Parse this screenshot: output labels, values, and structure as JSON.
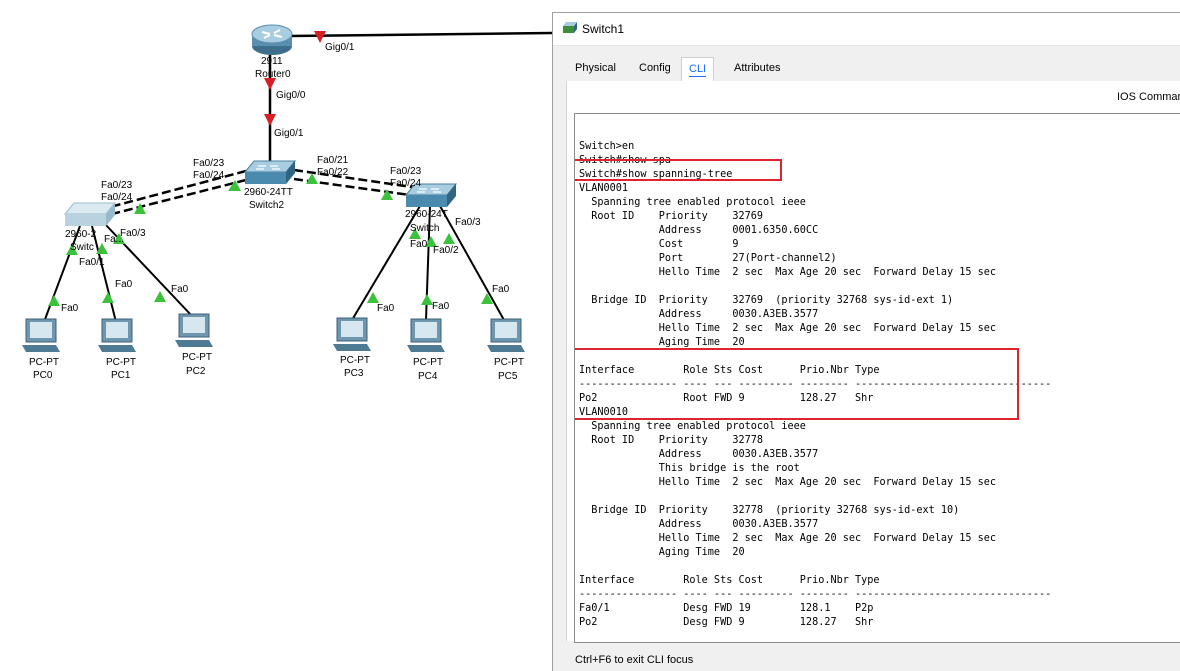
{
  "topology": {
    "labels": {
      "router_model": "2911",
      "router_name": "Router0",
      "router_gig01": "Gig0/1",
      "router_gig00": "Gig0/0",
      "sw2_gig01": "Gig0/1",
      "sw2_fa023": "Fa0/23",
      "sw2_fa024": "Fa0/24",
      "sw2_fa021": "Fa0/21",
      "sw2_fa022": "Fa0/22",
      "sw2_model": "2960-24TT",
      "sw2_name": "Switch2",
      "swl_fa023": "Fa0/23",
      "swl_fa024": "Fa0/24",
      "swl_model": "2960-2",
      "swl_name": "Switc",
      "swl_fa01": "Fa0/1",
      "swl_fa02": "Fa...",
      "swl_fa03": "Fa0/3",
      "swr_fa023": "Fa0/23",
      "swr_fa024": "Fa0/24",
      "swr_model": "2960-24T",
      "swr_name": "Switch",
      "swr_fa0": "Fa0",
      "swr_fa02": "Fa0/2",
      "swr_fa03": "Fa0/3",
      "pc_port": "Fa0",
      "pc_type": "PC-PT",
      "pcs": [
        "PC0",
        "PC1",
        "PC2",
        "PC3",
        "PC4",
        "PC5"
      ]
    }
  },
  "window": {
    "title": "Switch1",
    "tabs": [
      "Physical",
      "Config",
      "CLI",
      "Attributes"
    ],
    "active_tab": "CLI",
    "ios_title": "IOS Command",
    "footer": "Ctrl+F6 to exit CLI focus",
    "highlight_color": "#e0242f",
    "cli_lines": [
      "Switch>en",
      "Switch#show spa",
      "Switch#show spanning-tree",
      "VLAN0001",
      "  Spanning tree enabled protocol ieee",
      "  Root ID    Priority    32769",
      "             Address     0001.6350.60CC",
      "             Cost        9",
      "             Port        27(Port-channel2)",
      "             Hello Time  2 sec  Max Age 20 sec  Forward Delay 15 sec",
      "",
      "  Bridge ID  Priority    32769  (priority 32768 sys-id-ext 1)",
      "             Address     0030.A3EB.3577",
      "             Hello Time  2 sec  Max Age 20 sec  Forward Delay 15 sec",
      "             Aging Time  20",
      "",
      "Interface        Role Sts Cost      Prio.Nbr Type",
      "---------------- ---- --- --------- -------- --------------------------------",
      "Po2              Root FWD 9         128.27   Shr",
      "VLAN0010",
      "  Spanning tree enabled protocol ieee",
      "  Root ID    Priority    32778",
      "             Address     0030.A3EB.3577",
      "             This bridge is the root",
      "             Hello Time  2 sec  Max Age 20 sec  Forward Delay 15 sec",
      "",
      "  Bridge ID  Priority    32778  (priority 32768 sys-id-ext 10)",
      "             Address     0030.A3EB.3577",
      "             Hello Time  2 sec  Max Age 20 sec  Forward Delay 15 sec",
      "             Aging Time  20",
      "",
      "Interface        Role Sts Cost      Prio.Nbr Type",
      "---------------- ---- --- --------- -------- --------------------------------",
      "Fa0/1            Desg FWD 19        128.1    P2p",
      "Po2              Desg FWD 9         128.27   Shr"
    ]
  }
}
